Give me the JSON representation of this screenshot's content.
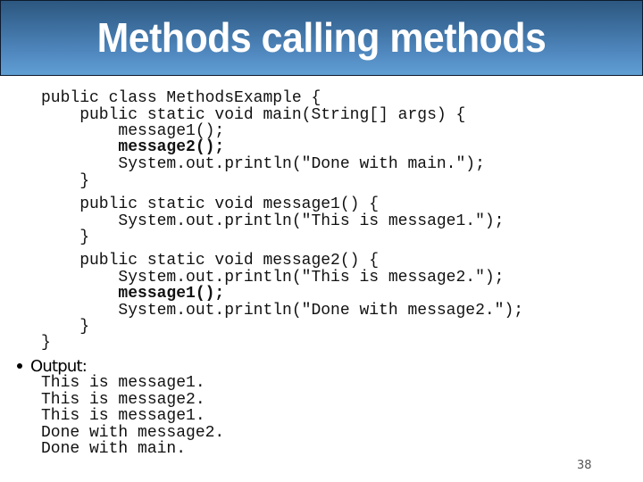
{
  "slide": {
    "title": "Methods calling methods",
    "page_number": "38",
    "colors": {
      "title_gradient_top": "#2c577f",
      "title_gradient_bottom": "#609fd4",
      "title_text": "#ffffff",
      "body_text": "#111111"
    }
  },
  "code": {
    "lines": [
      {
        "text": "public class MethodsExample {",
        "bold": false
      },
      {
        "text": "    public static void main(String[] args) {",
        "bold": false
      },
      {
        "text": "        message1();",
        "bold": false
      },
      {
        "text": "        message2();",
        "bold": true
      },
      {
        "text": "        System.out.println(\"Done with main.\");",
        "bold": false
      },
      {
        "text": "    }",
        "bold": false
      },
      {
        "text": "    public static void message1() {",
        "bold": false
      },
      {
        "text": "        System.out.println(\"This is message1.\");",
        "bold": false
      },
      {
        "text": "    }",
        "bold": false
      },
      {
        "text": "    public static void message2() {",
        "bold": false
      },
      {
        "text": "        System.out.println(\"This is message2.\");",
        "bold": false
      },
      {
        "text": "        message1();",
        "bold": true
      },
      {
        "text": "        System.out.println(\"Done with message2.\");",
        "bold": false
      },
      {
        "text": "    }",
        "bold": false
      },
      {
        "text": "}",
        "bold": false
      }
    ]
  },
  "output": {
    "label": "Output:",
    "lines": [
      "This is message1.",
      "This is message2.",
      "This is message1.",
      "Done with message2.",
      "Done with main."
    ]
  }
}
